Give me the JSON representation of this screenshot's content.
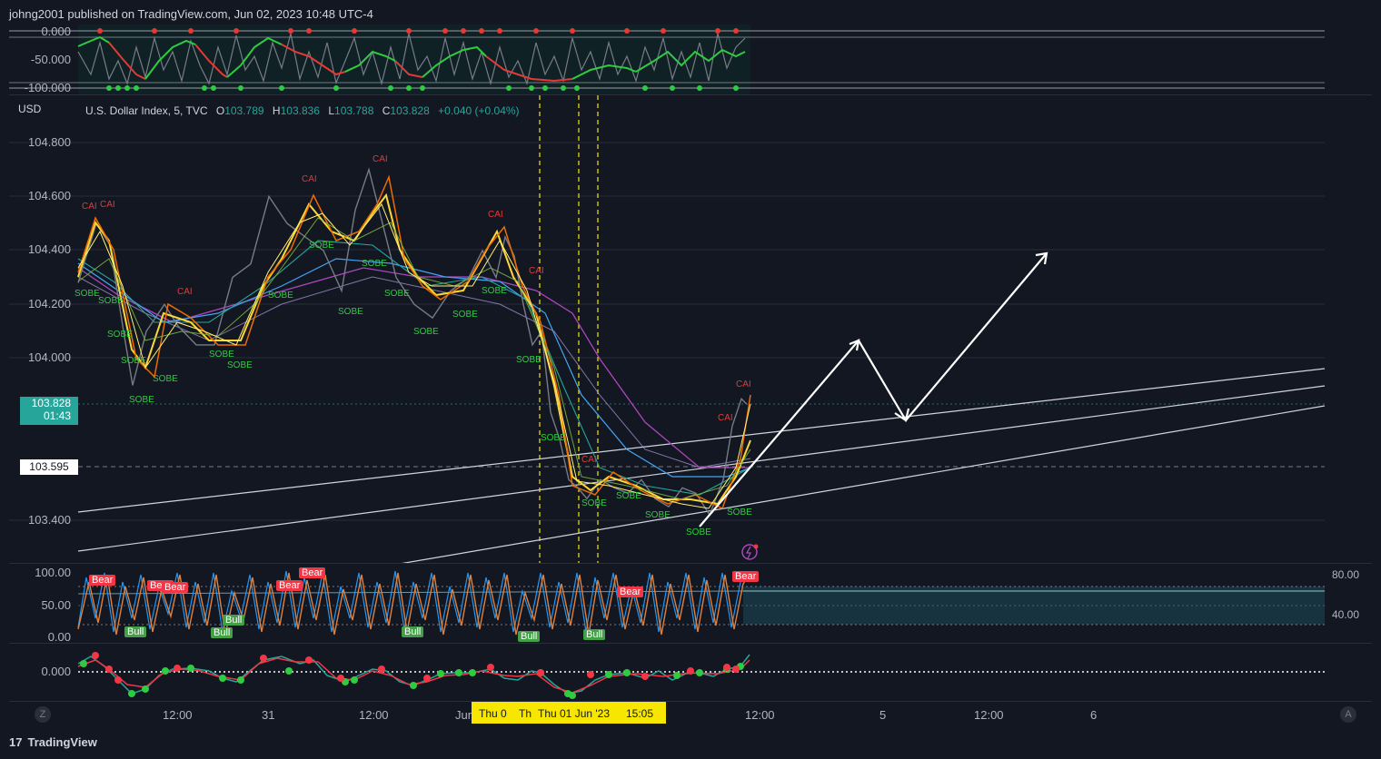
{
  "header": {
    "publisher_line": "johng2001 published on TradingView.com, Jun 02, 2023 10:48 UTC-4"
  },
  "top_pane": {
    "y_labels": [
      "0.000",
      "-50.000",
      "-100.000"
    ]
  },
  "main_pane": {
    "currency": "USD",
    "symbol": "U.S. Dollar Index, 5, TVC",
    "open_label": "O",
    "open": "103.789",
    "high_label": "H",
    "high": "103.836",
    "low_label": "L",
    "low": "103.788",
    "close_label": "C",
    "close": "103.828",
    "change": "+0.040 (+0.04%)",
    "y_labels": [
      "104.800",
      "104.600",
      "104.400",
      "104.200",
      "104.000",
      "103.400"
    ],
    "price_tag": {
      "price": "103.828",
      "countdown": "01:43"
    },
    "level_tag": "103.595",
    "sobe_label": "SOBE",
    "cai_label": "CAI"
  },
  "stoch_pane": {
    "y_labels": [
      "100.00",
      "50.00",
      "0.00"
    ],
    "right_labels": [
      "80.00",
      "40.00"
    ],
    "bear_label": "Bear",
    "bull_label": "Bull"
  },
  "osc_pane": {
    "y_labels": [
      "0.000"
    ]
  },
  "time_axis": {
    "labels": [
      "12:00",
      "31",
      "12:00",
      "Jun",
      "12:00",
      "5",
      "12:00",
      "6"
    ],
    "crosshair": {
      "a": "Thu 0",
      "b": "Th",
      "c": "Thu 01 Jun '23",
      "d": "15:05"
    },
    "left_button": "Z",
    "right_button": "A"
  },
  "footer": {
    "brand": "TradingView",
    "logo": "17"
  },
  "colors": {
    "background": "#131722",
    "up": "#26a69a",
    "down": "#f23645",
    "crosshair": "#f7e600",
    "sobe": "#2ecc40",
    "cai": "#e53935"
  },
  "icons": [
    "lightning-alert-icon",
    "tradingview-logo-icon"
  ],
  "chart_data": {
    "type": "line",
    "title": "U.S. Dollar Index, 5, TVC",
    "ylabel": "USD",
    "ylim": [
      103.28,
      104.85
    ],
    "series": [
      {
        "name": "U.S. Dollar Index",
        "points": [
          [
            0,
            104.28
          ],
          [
            20,
            104.5
          ],
          [
            35,
            104.42
          ],
          [
            50,
            104.1
          ],
          [
            60,
            103.9
          ],
          [
            75,
            104.1
          ],
          [
            95,
            104.2
          ],
          [
            110,
            104.12
          ],
          [
            130,
            104.05
          ],
          [
            150,
            104.05
          ],
          [
            170,
            104.3
          ],
          [
            190,
            104.35
          ],
          [
            210,
            104.6
          ],
          [
            230,
            104.5
          ],
          [
            250,
            104.45
          ],
          [
            270,
            104.4
          ],
          [
            290,
            104.25
          ],
          [
            305,
            104.55
          ],
          [
            320,
            104.7
          ],
          [
            335,
            104.5
          ],
          [
            350,
            104.3
          ],
          [
            370,
            104.2
          ],
          [
            390,
            104.15
          ],
          [
            410,
            104.25
          ],
          [
            430,
            104.3
          ],
          [
            445,
            104.4
          ],
          [
            460,
            104.3
          ],
          [
            470,
            104.45
          ],
          [
            480,
            104.38
          ],
          [
            490,
            104.2
          ],
          [
            500,
            104.05
          ],
          [
            510,
            104.1
          ],
          [
            520,
            103.8
          ],
          [
            530,
            103.7
          ],
          [
            540,
            103.55
          ],
          [
            550,
            103.52
          ],
          [
            560,
            103.48
          ],
          [
            575,
            103.55
          ],
          [
            590,
            103.52
          ],
          [
            605,
            103.5
          ],
          [
            620,
            103.55
          ],
          [
            635,
            103.48
          ],
          [
            650,
            103.45
          ],
          [
            665,
            103.52
          ],
          [
            680,
            103.5
          ],
          [
            695,
            103.42
          ],
          [
            710,
            103.55
          ],
          [
            720,
            103.75
          ],
          [
            730,
            103.85
          ],
          [
            736,
            103.83
          ]
        ]
      }
    ],
    "projection": [
      [
        736,
        103.6
      ],
      [
        860,
        104.05
      ],
      [
        910,
        103.78
      ],
      [
        1070,
        104.38
      ]
    ]
  }
}
